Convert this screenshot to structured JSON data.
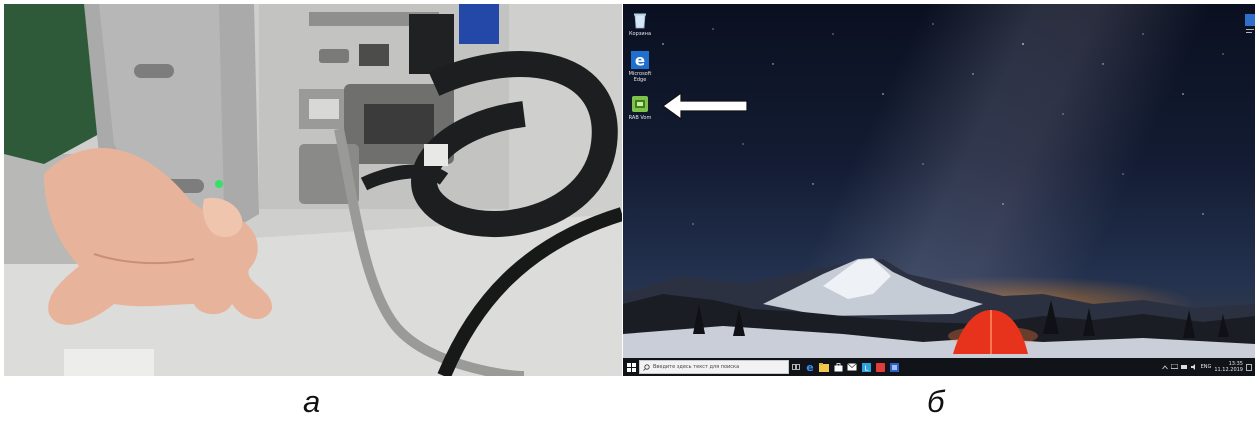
{
  "panels": {
    "a": {
      "caption": "а"
    },
    "b": {
      "caption": "б"
    }
  },
  "desktop": {
    "icons": [
      {
        "label": "Корзина",
        "icon": "recycle-bin-icon"
      },
      {
        "label": "Microsoft Edge",
        "icon": "edge-icon"
      },
      {
        "label": "RAB Vom",
        "icon": "app-icon"
      }
    ],
    "arrow_target": "app-icon",
    "taskbar": {
      "search_placeholder": "Введите здесь текст для поиска",
      "language": "ENG",
      "time": "13:35",
      "date": "11.12.2019",
      "pinned": [
        "task-view-icon",
        "edge-icon",
        "explorer-icon",
        "store-icon",
        "mail-icon",
        "app-l-icon",
        "app-red-icon",
        "app-blue-icon"
      ]
    }
  },
  "colors": {
    "tent": "#e8331c",
    "horizon_glow": "#ff9628",
    "taskbar": "#101318",
    "arrow": "#ffffff"
  }
}
